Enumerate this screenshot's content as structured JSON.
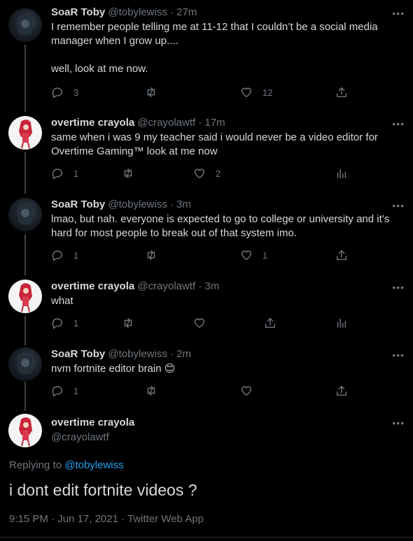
{
  "tweets": [
    {
      "name": "SoaR Toby",
      "meta": "@tobylewiss · 27m",
      "lines": [
        "I remember people telling me at 11-12 that I couldn’t be a social media",
        "manager when I grow up....",
        "",
        "well, look at me now."
      ],
      "reply_count": "3",
      "retweet_count": "",
      "like_count": "12"
    },
    {
      "name": "overtime crayola",
      "meta": "@crayolawtf · 17m",
      "lines": [
        "same when i was 9 my teacher said i would never be a video editor for",
        "Overtime Gaming™ look at me now"
      ],
      "reply_count": "1",
      "retweet_count": "",
      "like_count": "2"
    },
    {
      "name": "SoaR Toby",
      "meta": "@tobylewiss · 3m",
      "lines": [
        "lmao, but nah. everyone is expected to go to college or university and it’s",
        "hard for most people to break out of that system imo."
      ],
      "reply_count": "1",
      "retweet_count": "",
      "like_count": "1"
    },
    {
      "name": "overtime crayola",
      "meta": "@crayolawtf · 3m",
      "lines": [
        "what"
      ],
      "reply_count": "1",
      "retweet_count": "",
      "like_count": ""
    },
    {
      "name": "SoaR Toby",
      "meta": "@tobylewiss · 2m",
      "lines": [
        "nvm fortnite editor brain 😊"
      ],
      "reply_count": "1",
      "retweet_count": "",
      "like_count": ""
    }
  ],
  "main": {
    "name": "overtime crayola",
    "handle": "@crayolawtf",
    "replying_prefix": "Replying to ",
    "replying_to": "@tobylewiss",
    "text": "i dont edit fortnite videos ?",
    "meta": "9:15 PM · Jun 17, 2021 · Twitter Web App"
  },
  "icons": {
    "reply": "reply-icon",
    "retweet": "retweet-icon",
    "like": "like-icon",
    "share": "share-icon",
    "analytics": "analytics-icon",
    "more": "more-icon"
  },
  "colors": {
    "background": "#000000",
    "text": "#d9d9d9",
    "secondary": "#6e767d",
    "link": "#1da1f2"
  }
}
